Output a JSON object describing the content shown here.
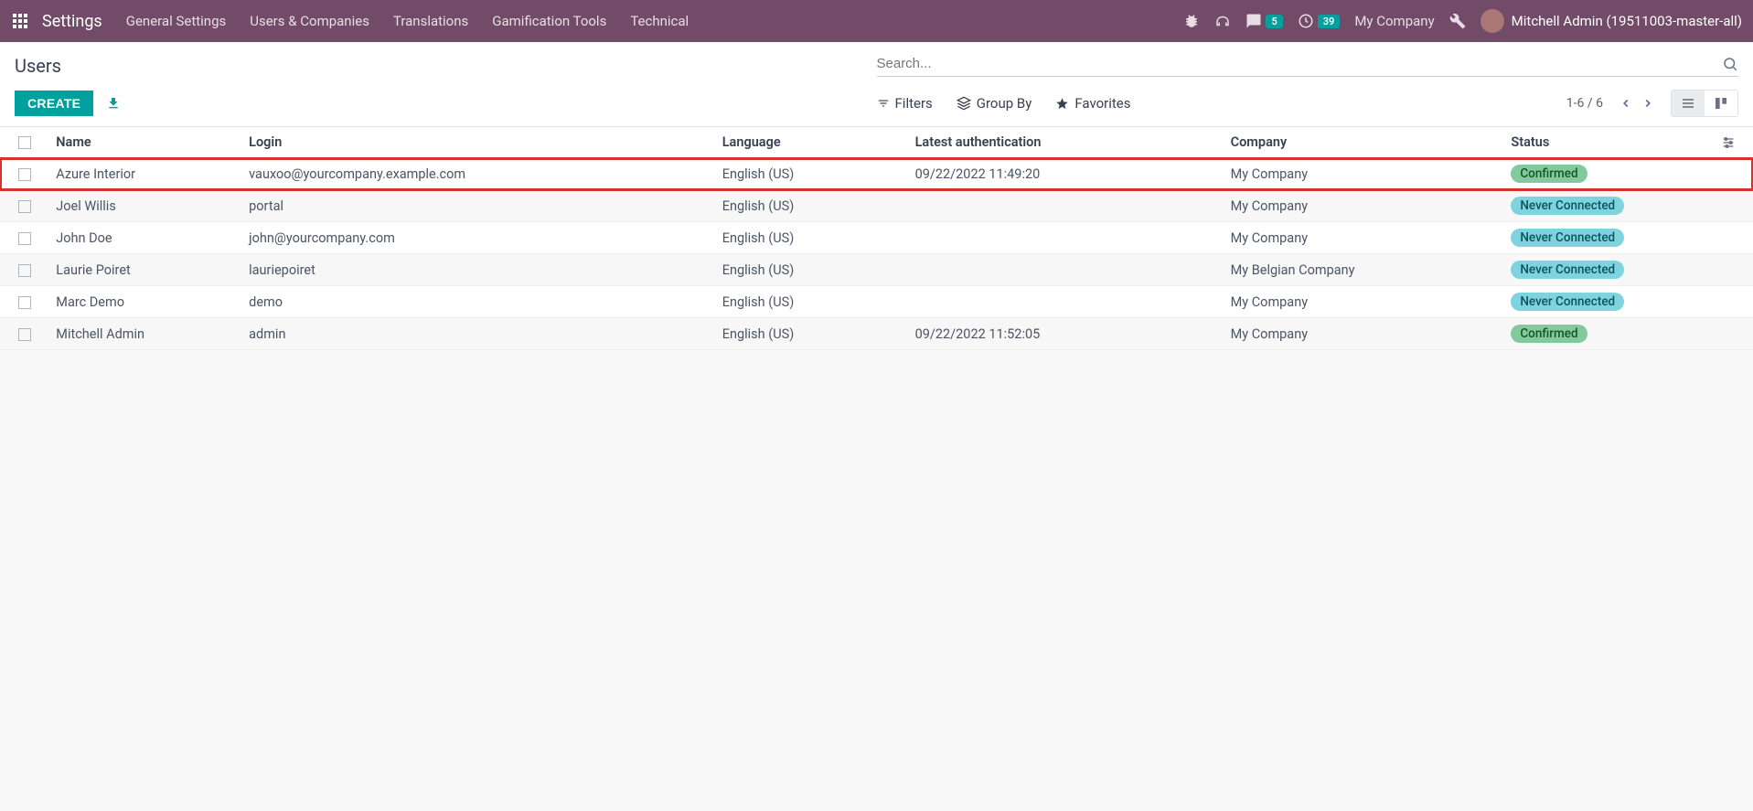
{
  "nav": {
    "brand": "Settings",
    "menu": [
      "General Settings",
      "Users & Companies",
      "Translations",
      "Gamification Tools",
      "Technical"
    ],
    "messages_count": "5",
    "activities_count": "39",
    "company": "My Company",
    "user_display": "Mitchell Admin (19511003-master-all)"
  },
  "cp": {
    "breadcrumb": "Users",
    "search_placeholder": "Search...",
    "create_label": "CREATE",
    "filters_label": "Filters",
    "groupby_label": "Group By",
    "favorites_label": "Favorites",
    "pager_text": "1-6 / 6"
  },
  "table": {
    "headers": {
      "name": "Name",
      "login": "Login",
      "language": "Language",
      "latest_auth": "Latest authentication",
      "company": "Company",
      "status": "Status"
    },
    "rows": [
      {
        "highlight": true,
        "name": "Azure Interior",
        "login": "vauxoo@yourcompany.example.com",
        "language": "English (US)",
        "latest_auth": "09/22/2022 11:49:20",
        "company": "My Company",
        "status": "Confirmed",
        "status_kind": "confirmed"
      },
      {
        "highlight": false,
        "name": "Joel Willis",
        "login": "portal",
        "language": "English (US)",
        "latest_auth": "",
        "company": "My Company",
        "status": "Never Connected",
        "status_kind": "never"
      },
      {
        "highlight": false,
        "name": "John Doe",
        "login": "john@yourcompany.com",
        "language": "English (US)",
        "latest_auth": "",
        "company": "My Company",
        "status": "Never Connected",
        "status_kind": "never"
      },
      {
        "highlight": false,
        "name": "Laurie Poiret",
        "login": "lauriepoiret",
        "language": "English (US)",
        "latest_auth": "",
        "company": "My Belgian Company",
        "status": "Never Connected",
        "status_kind": "never"
      },
      {
        "highlight": false,
        "name": "Marc Demo",
        "login": "demo",
        "language": "English (US)",
        "latest_auth": "",
        "company": "My Company",
        "status": "Never Connected",
        "status_kind": "never"
      },
      {
        "highlight": false,
        "name": "Mitchell Admin",
        "login": "admin",
        "language": "English (US)",
        "latest_auth": "09/22/2022 11:52:05",
        "company": "My Company",
        "status": "Confirmed",
        "status_kind": "confirmed"
      }
    ]
  }
}
